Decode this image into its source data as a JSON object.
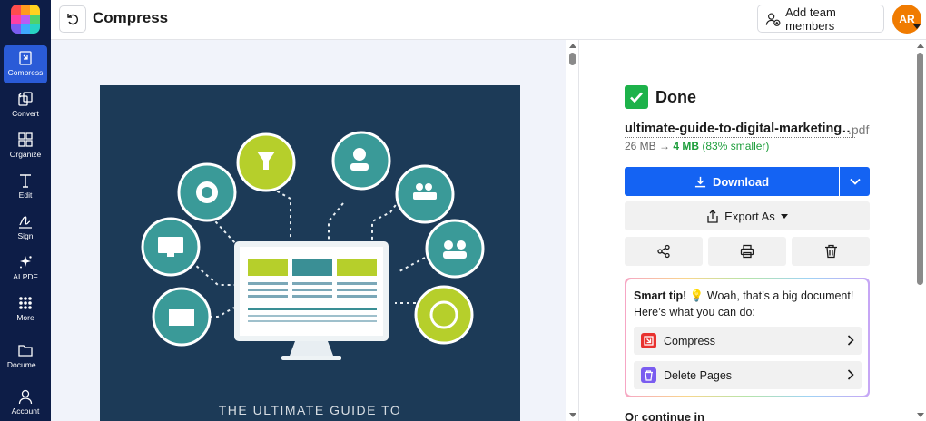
{
  "rail": {
    "items": [
      {
        "label": "Compress",
        "icon": "compress-icon",
        "active": true
      },
      {
        "label": "Convert",
        "icon": "convert-icon"
      },
      {
        "label": "Organize",
        "icon": "organize-icon"
      },
      {
        "label": "Edit",
        "icon": "edit-icon"
      },
      {
        "label": "Sign",
        "icon": "sign-icon"
      },
      {
        "label": "AI PDF",
        "icon": "sparkle-icon"
      },
      {
        "label": "More",
        "icon": "grid-icon"
      },
      {
        "label": "Docume…",
        "icon": "folder-icon"
      },
      {
        "label": "Account",
        "icon": "user-icon"
      }
    ]
  },
  "header": {
    "title": "Compress",
    "team_button": "Add team members",
    "avatar_initials": "AR"
  },
  "document": {
    "caption": "THE ULTIMATE GUIDE TO"
  },
  "result": {
    "status": "Done",
    "file_name": "ultimate-guide-to-digital-marketing…",
    "file_ext": ".pdf",
    "old_size": "26 MB",
    "arrow": "→",
    "new_size": "4 MB",
    "reduction": "(83% smaller)",
    "download_label": "Download",
    "export_label": "Export As"
  },
  "smart_tip": {
    "heading": "Smart tip!",
    "emoji": "💡",
    "line1": "Woah, that’s a big document!",
    "line2": "Here’s what you can do:",
    "actions": [
      {
        "label": "Compress",
        "icon": "compress-icon",
        "color": "#e8322f"
      },
      {
        "label": "Delete Pages",
        "icon": "trash-icon",
        "color": "#7a5cf0"
      }
    ]
  },
  "continue_label": "Or continue in",
  "colors": {
    "rail_bg": "#0d1d47",
    "rail_active": "#2a5bd7",
    "primary": "#1463f3",
    "success": "#1db24a",
    "avatar": "#f07b00"
  }
}
